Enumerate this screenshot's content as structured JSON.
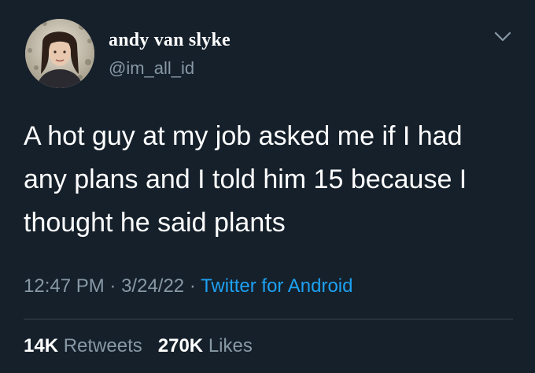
{
  "user": {
    "display_name": "andy van slyke",
    "handle": "@im_all_id",
    "avatar_icon": "profile-photo"
  },
  "tweet": {
    "text": "A hot guy at my job asked me if I had\nany plans and I told him 15 because I\nthought he said plants",
    "time": "12:47 PM",
    "separator1": "·",
    "date": "3/24/22",
    "separator2": "·",
    "source": "Twitter for Android"
  },
  "stats": {
    "retweets_count": "14K",
    "retweets_label": "Retweets",
    "likes_count": "270K",
    "likes_label": "Likes"
  },
  "colors": {
    "background": "#15202b",
    "secondary_text": "#8899a6",
    "accent": "#1da1f2",
    "divider": "#38444d"
  },
  "icons": {
    "menu": "chevron-down-icon"
  }
}
